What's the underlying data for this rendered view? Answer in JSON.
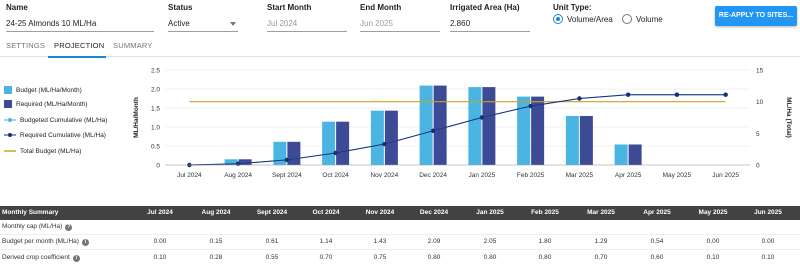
{
  "header": {
    "name_label": "Name",
    "name_value": "24-25 Almonds 10 ML/Ha",
    "status_label": "Status",
    "status_value": "Active",
    "start_label": "Start Month",
    "start_value": "Jul 2024",
    "end_label": "End Month",
    "end_value": "Jun 2025",
    "area_label": "Irrigated Area (Ha)",
    "area_value": "2.860",
    "unit_label": "Unit Type:",
    "unit_options": [
      "Volume/Area",
      "Volume"
    ],
    "unit_selected": "Volume/Area",
    "reapply_button": "RE-APPLY TO SITES..."
  },
  "tabs": {
    "items": [
      "SETTINGS",
      "PROJECTION",
      "SUMMARY"
    ],
    "active": "PROJECTION"
  },
  "legend": {
    "budget": "Budget (ML/Ha/Month)",
    "required": "Required (ML/Ha/Month)",
    "budgeted_cum": "Budgeted Cumulative (ML/Ha)",
    "required_cum": "Required Cumulative (ML/Ha)",
    "total_budget": "Total Budget (ML/Ha)"
  },
  "colors": {
    "budget": "#4ab5e3",
    "required": "#3d4a96",
    "budgeted_cum": "#4ab5e3",
    "required_cum": "#1c2c78",
    "total_budget": "#c9a227",
    "accent": "#1a86d1"
  },
  "chart_data": {
    "type": "bar",
    "categories": [
      "Jul 2024",
      "Aug 2024",
      "Sept 2024",
      "Oct 2024",
      "Nov 2024",
      "Dec 2024",
      "Jan 2025",
      "Feb 2025",
      "Mar 2025",
      "Apr 2025",
      "May 2025",
      "Jun 2025"
    ],
    "series": [
      {
        "name": "Budget (ML/Ha/Month)",
        "kind": "bar",
        "axis": "left",
        "values": [
          0.0,
          0.15,
          0.61,
          1.14,
          1.43,
          2.09,
          2.05,
          1.8,
          1.29,
          0.54,
          0.0,
          0.0
        ]
      },
      {
        "name": "Required (ML/Ha/Month)",
        "kind": "bar",
        "axis": "left",
        "values": [
          0.0,
          0.15,
          0.61,
          1.14,
          1.43,
          2.09,
          2.05,
          1.8,
          1.29,
          0.54,
          0.0,
          0.0
        ]
      },
      {
        "name": "Budgeted Cumulative (ML/Ha)",
        "kind": "line",
        "axis": "right",
        "values": [
          0.0,
          0.2,
          0.8,
          1.9,
          3.3,
          5.4,
          7.5,
          9.3,
          10.5,
          11.1,
          11.1,
          11.1
        ]
      },
      {
        "name": "Required Cumulative (ML/Ha)",
        "kind": "line",
        "axis": "right",
        "values": [
          0.0,
          0.2,
          0.8,
          1.9,
          3.3,
          5.4,
          7.5,
          9.3,
          10.5,
          11.1,
          11.1,
          11.1
        ]
      },
      {
        "name": "Total Budget (ML/Ha)",
        "kind": "line",
        "axis": "right",
        "values": [
          10,
          10,
          10,
          10,
          10,
          10,
          10,
          10,
          10,
          10,
          10,
          10
        ]
      }
    ],
    "ylabel": "ML/Ha/Month",
    "y2label": "ML/Ha (Total)",
    "ylim": [
      0,
      2.5
    ],
    "y2lim": [
      0,
      15
    ],
    "yticks": [
      "0",
      "0.5",
      "1.0",
      "1.5",
      "2.0",
      "2.5"
    ],
    "y2ticks": [
      "0",
      "5",
      "10",
      "15"
    ],
    "grid": true,
    "legend_position": "left"
  },
  "table": {
    "header_label": "Monthly Summary",
    "columns": [
      "Jul 2024",
      "Aug 2024",
      "Sept 2024",
      "Oct 2024",
      "Nov 2024",
      "Dec 2024",
      "Jan 2025",
      "Feb 2025",
      "Mar 2025",
      "Apr 2025",
      "May 2025",
      "Jun 2025"
    ],
    "rows": [
      {
        "label": "Monthly cap (ML/Ha)",
        "icon": "help-icon",
        "values": [
          "",
          "",
          "",
          "",
          "",
          "",
          "",
          "",
          "",
          "",
          "",
          ""
        ]
      },
      {
        "label": "Budget per month (ML/Ha)",
        "icon": "info-icon",
        "values": [
          "0.00",
          "0.15",
          "0.61",
          "1.14",
          "1.43",
          "2.09",
          "2.05",
          "1.80",
          "1.29",
          "0.54",
          "0.00",
          "0.00"
        ]
      },
      {
        "label": "Derived crop coefficient",
        "icon": "info-icon",
        "values": [
          "0.10",
          "0.28",
          "0.55",
          "0.70",
          "0.75",
          "0.80",
          "0.80",
          "0.80",
          "0.70",
          "0.60",
          "0.10",
          "0.10"
        ]
      }
    ]
  }
}
